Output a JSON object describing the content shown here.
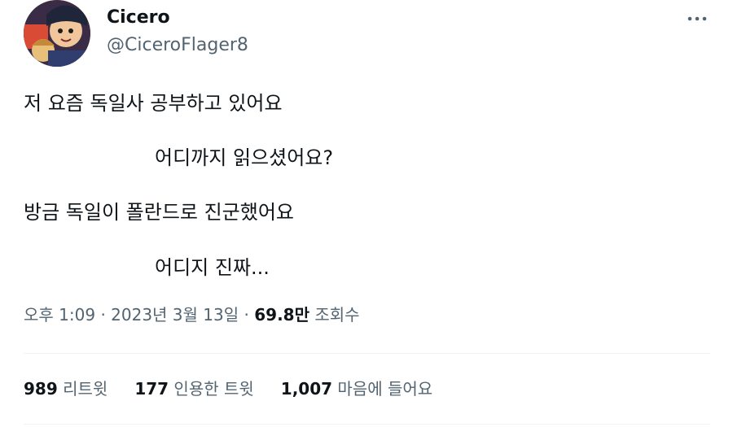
{
  "user": {
    "display_name": "Cicero",
    "handle": "@CiceroFlager8"
  },
  "tweet": {
    "lines": [
      "저 요즘 독일사 공부하고 있어요",
      "어디까지 읽으셨어요?",
      "방금 독일이 폴란드로 진군했어요",
      "어디지 진짜..."
    ]
  },
  "meta": {
    "time": "오후 1:09",
    "separator": "·",
    "date": "2023년 3월 13일",
    "views_count": "69.8만",
    "views_label": "조회수"
  },
  "stats": {
    "retweets_count": "989",
    "retweets_label": "리트윗",
    "quotes_count": "177",
    "quotes_label": "인용한 트윗",
    "likes_count": "1,007",
    "likes_label": "마음에 들어요"
  },
  "icons": {
    "more": "more-horizontal-icon"
  },
  "colors": {
    "text_primary": "#0f1419",
    "text_secondary": "#536471",
    "divider": "#eff3f4"
  }
}
